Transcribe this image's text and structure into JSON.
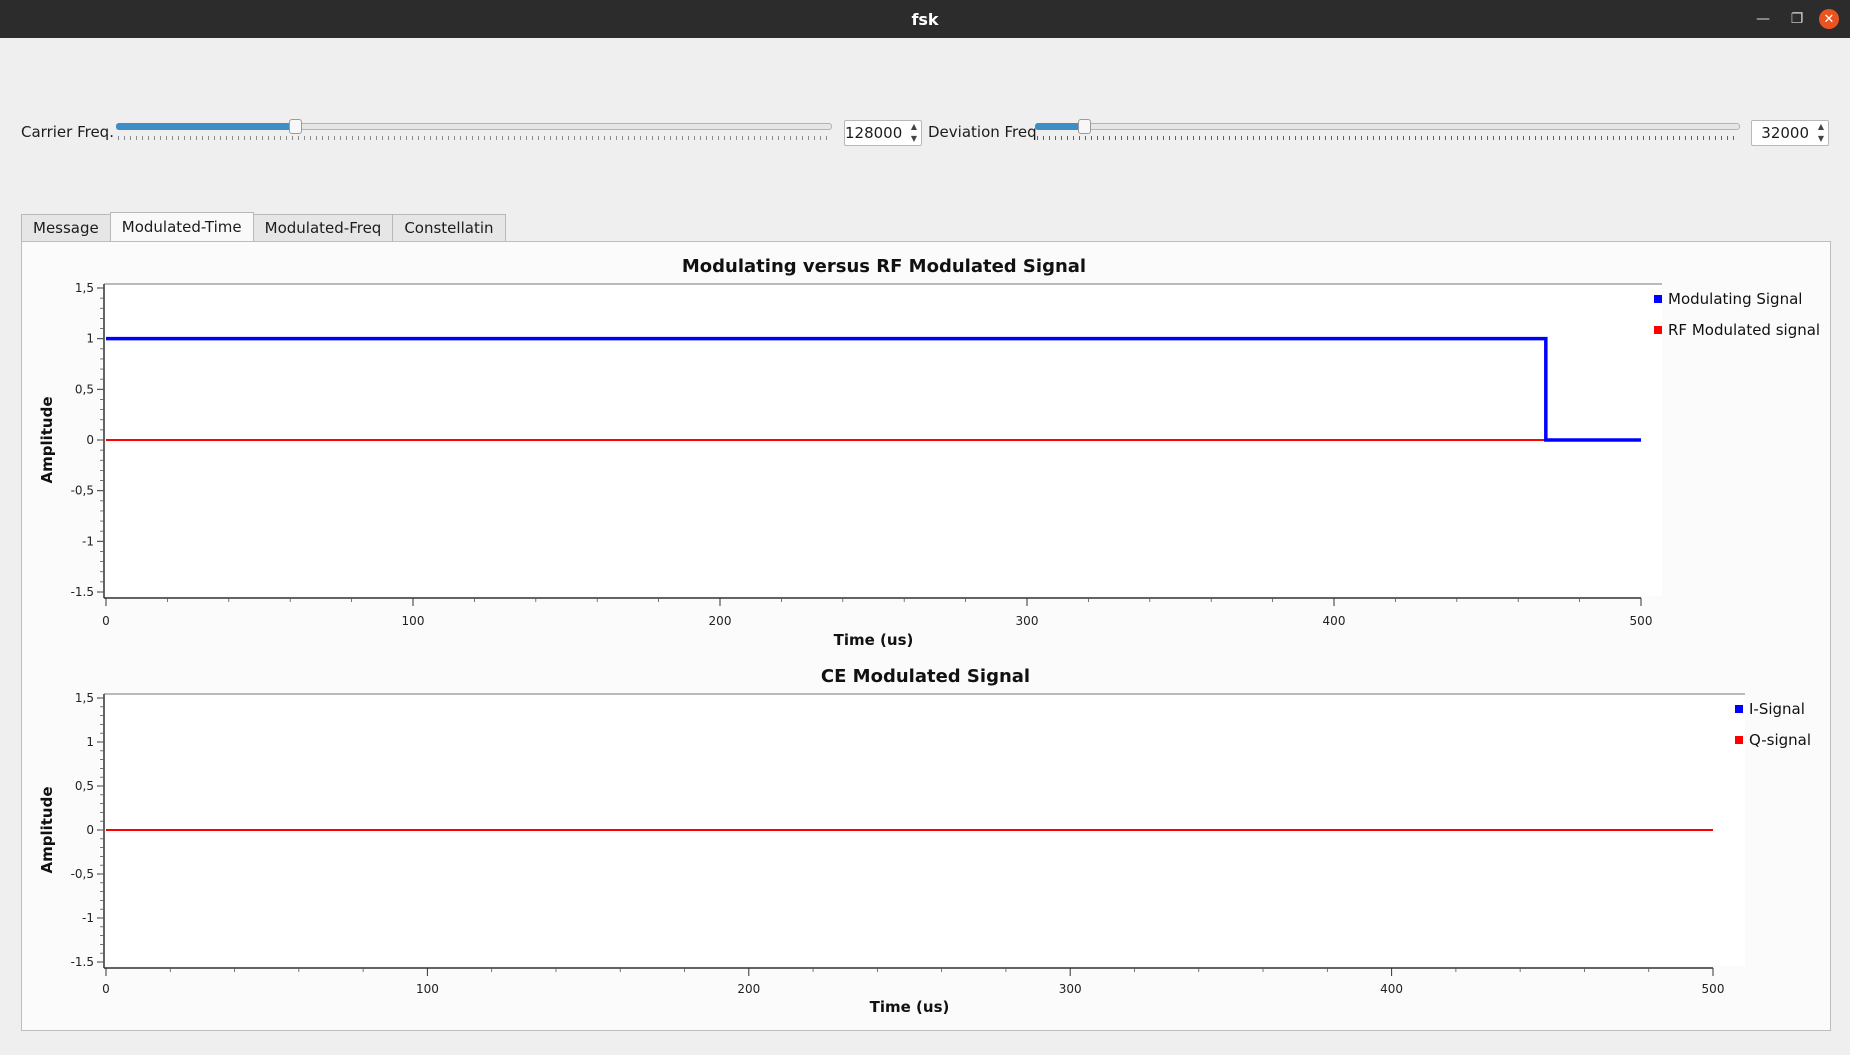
{
  "window": {
    "title": "fsk"
  },
  "controls": {
    "carrier": {
      "label": "Carrier Freq.",
      "value": "128000",
      "level": 0.25
    },
    "deviation": {
      "label": "Deviation Freq",
      "value": "32000",
      "level": 0.07
    }
  },
  "tabs": [
    {
      "label": "Message"
    },
    {
      "label": "Modulated-Time"
    },
    {
      "label": "Modulated-Freq"
    },
    {
      "label": "Constellatin"
    }
  ],
  "active_tab": 1,
  "chart_data": [
    {
      "type": "line",
      "title": "Modulating versus RF Modulated Signal",
      "xlabel": "Time (us)",
      "ylabel": "Amplitude",
      "xlim": [
        0,
        500
      ],
      "ylim": [
        -1.5,
        1.5
      ],
      "x_ticks": [
        "0",
        "100",
        "200",
        "300",
        "400",
        "500"
      ],
      "y_ticks": [
        "1,5",
        "1",
        "0,5",
        "0",
        "-0,5",
        "-1",
        "-1.5"
      ],
      "legend": "right",
      "series": [
        {
          "name": "Modulating Signal",
          "color": "#0000ff",
          "x": [
            0,
            469,
            469,
            500
          ],
          "y": [
            1,
            1,
            0,
            0
          ]
        },
        {
          "name": "RF Modulated signal",
          "color": "#ff0000",
          "x": [
            0,
            500
          ],
          "y": [
            0,
            0
          ]
        }
      ]
    },
    {
      "type": "line",
      "title": "CE Modulated Signal",
      "xlabel": "Time (us)",
      "ylabel": "Amplitude",
      "xlim": [
        0,
        500
      ],
      "ylim": [
        -1.5,
        1.5
      ],
      "x_ticks": [
        "0",
        "100",
        "200",
        "300",
        "400",
        "500"
      ],
      "y_ticks": [
        "1,5",
        "1",
        "0,5",
        "0",
        "-0,5",
        "-1",
        "-1.5"
      ],
      "legend": "right",
      "series": [
        {
          "name": "I-Signal",
          "color": "#0000ff",
          "x": [],
          "y": []
        },
        {
          "name": "Q-signal",
          "color": "#ff0000",
          "x": [
            0,
            500
          ],
          "y": [
            0,
            0
          ]
        }
      ]
    }
  ]
}
